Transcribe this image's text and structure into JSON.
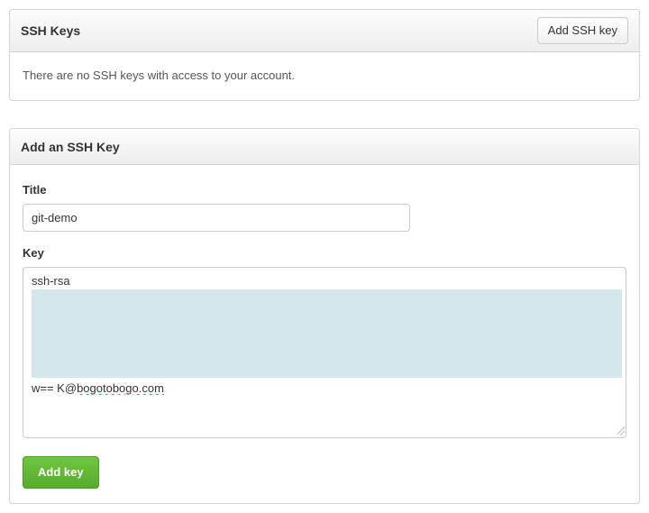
{
  "ssh_keys_panel": {
    "title": "SSH Keys",
    "add_button_label": "Add SSH key",
    "empty_message": "There are no SSH keys with access to your account."
  },
  "add_key_panel": {
    "title": "Add an SSH Key",
    "title_label": "Title",
    "title_value": "git-demo",
    "key_label": "Key",
    "key_value_first_line": "ssh-rsa",
    "key_value_last_prefix": "w== K@",
    "key_value_last_domain": "bogotobogo.com",
    "submit_label": "Add key"
  },
  "colors": {
    "selection_bg": "#d4e7ea",
    "success_button_bg": "#5fba30"
  }
}
